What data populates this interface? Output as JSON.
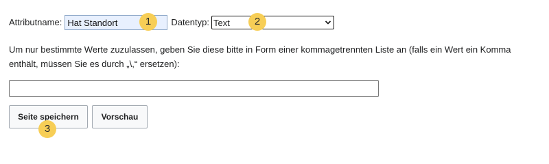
{
  "form": {
    "attribute_label": "Attributname:",
    "attribute_value": "Hat Standort",
    "type_label": "Datentyp:",
    "type_value": "Text",
    "description": "Um nur bestimmte Werte zuzulassen, geben Sie diese bitte in Form einer kommagetrennten Liste an (falls ein Wert ein Komma\nenthält, müssen Sie es durch „\\,“ ersetzen):",
    "value_list": "",
    "save_label": "Seite speichern",
    "preview_label": "Vorschau"
  },
  "markers": [
    "1",
    "2",
    "3"
  ],
  "colors": {
    "marker": "#f7ce56",
    "input_autofill": "#e8f0fe"
  }
}
